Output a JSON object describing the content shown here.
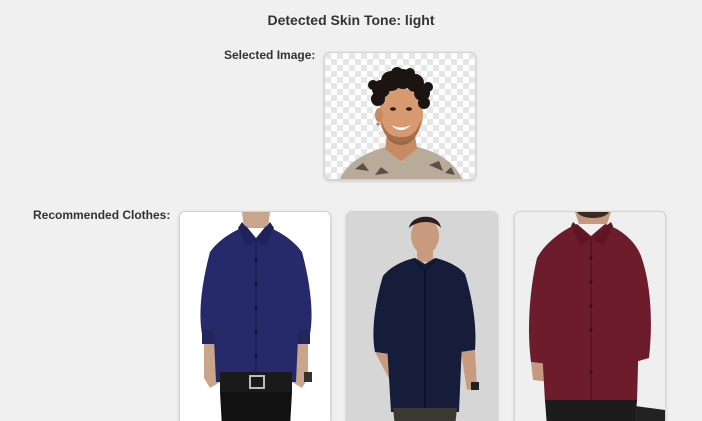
{
  "header": {
    "title": "Detected Skin Tone: light"
  },
  "selected": {
    "label": "Selected Image:",
    "image_icon": "person-portrait"
  },
  "recommendations": {
    "label": "Recommended Clothes:",
    "items": [
      {
        "icon": "navy-shirt-icon",
        "color": "#262a6a"
      },
      {
        "icon": "dark-navy-shirt-icon",
        "color": "#161d3a"
      },
      {
        "icon": "maroon-shirt-icon",
        "color": "#6d1c2c"
      }
    ]
  }
}
